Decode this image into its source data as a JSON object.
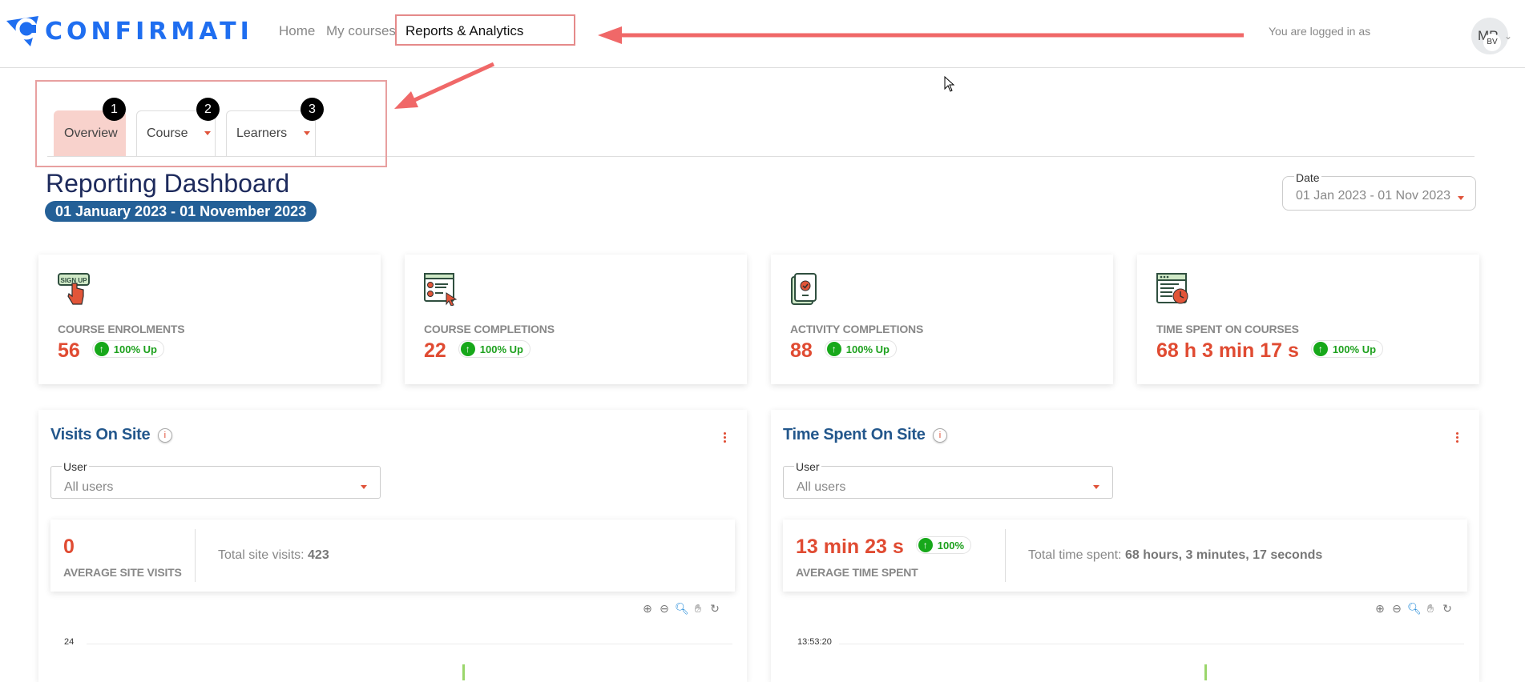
{
  "header": {
    "logo_text": "CONFIRMATION",
    "nav": [
      {
        "label": "Home"
      },
      {
        "label": "My courses"
      },
      {
        "label": "Reports & Analytics",
        "highlighted": true
      }
    ],
    "logged_in_text": "You are logged in as",
    "avatar": {
      "initials": "MP",
      "badge": "BV",
      "caret": "chevron-down-icon"
    }
  },
  "annotations": {
    "step_badges": [
      "1",
      "2",
      "3"
    ],
    "color": "#f06868"
  },
  "tabs": [
    {
      "label": "Overview",
      "active": true,
      "dropdown": false
    },
    {
      "label": "Course",
      "active": false,
      "dropdown": true
    },
    {
      "label": "Learners",
      "active": false,
      "dropdown": true
    }
  ],
  "dashboard": {
    "title": "Reporting Dashboard",
    "date_range_pill": "01 January 2023 - 01 November 2023",
    "date_filter": {
      "label": "Date",
      "value": "01 Jan 2023 - 01 Nov 2023"
    }
  },
  "cards": [
    {
      "icon": "sign-up-icon",
      "label": "COURSE ENROLMENTS",
      "value": "56",
      "trend": "100% Up"
    },
    {
      "icon": "course-checklist-icon",
      "label": "COURSE COMPLETIONS",
      "value": "22",
      "trend": "100% Up"
    },
    {
      "icon": "activity-document-icon",
      "label": "ACTIVITY COMPLETIONS",
      "value": "88",
      "trend": "100% Up"
    },
    {
      "icon": "time-browser-icon",
      "label": "TIME SPENT ON COURSES",
      "value": "68 h 3 min 17 s",
      "trend": "100% Up"
    }
  ],
  "panels": [
    {
      "title": "Visits On Site",
      "info_icon": "i",
      "user_filter": {
        "label": "User",
        "value": "All users"
      },
      "stat_value": "0",
      "stat_label": "AVERAGE SITE VISITS",
      "stat_trend": null,
      "total_prefix": "Total site visits: ",
      "total_value": "423",
      "chart": {
        "y_top_tick": "24"
      }
    },
    {
      "title": "Time Spent On Site",
      "info_icon": "i",
      "user_filter": {
        "label": "User",
        "value": "All users"
      },
      "stat_value": "13 min 23 s",
      "stat_label": "AVERAGE TIME SPENT",
      "stat_trend": "100%",
      "total_prefix": "Total time spent: ",
      "total_value": "68 hours, 3 minutes, 17 seconds",
      "chart": {
        "y_top_tick": "13:53:20"
      }
    }
  ],
  "chart_toolbar": [
    "zoom-in-icon",
    "zoom-out-icon",
    "selection-zoom-icon",
    "pan-icon",
    "reset-icon"
  ],
  "colors": {
    "accent_red": "#e04b32",
    "title_blue": "#23578c",
    "pill_blue": "#246097",
    "logo_blue": "#1f6ef0",
    "trend_green": "#17a81a",
    "active_tab_bg": "#f8d2cc"
  }
}
